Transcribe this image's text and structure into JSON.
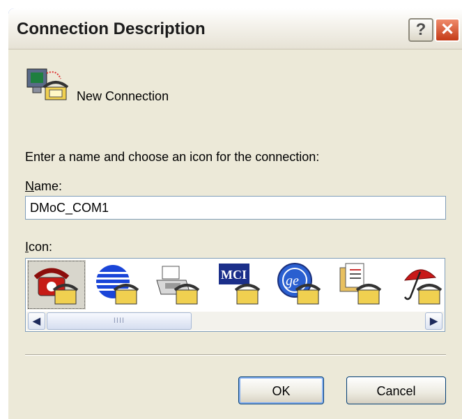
{
  "window": {
    "title": "Connection Description",
    "help_button": "?",
    "close_button": "✕"
  },
  "header": {
    "connection_name": "New Connection"
  },
  "prompt": "Enter a name and choose an icon for the connection:",
  "name_field": {
    "label_underlined": "N",
    "label_rest": "ame:",
    "value": "DMoC_COM1"
  },
  "icon_field": {
    "label_underlined": "I",
    "label_rest": "con:",
    "icons": [
      "red-phone-icon",
      "globe-phone-icon",
      "fax-phone-icon",
      "mci-phone-icon",
      "ge-phone-icon",
      "documents-phone-icon",
      "umbrella-phone-icon"
    ],
    "selected_index": 0
  },
  "scrollbar": {
    "left_arrow": "◀",
    "right_arrow": "▶",
    "grip": "IIII"
  },
  "buttons": {
    "ok": "OK",
    "cancel": "Cancel"
  },
  "colors": {
    "title_bar": "#f2f0e8",
    "close": "#d94f2b",
    "dialog_bg": "#ece9d8",
    "frame": "#0842c4"
  }
}
